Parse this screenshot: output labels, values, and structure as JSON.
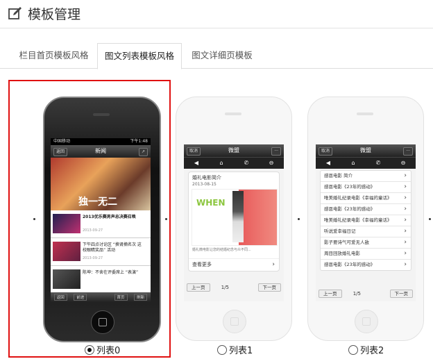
{
  "header": {
    "title": "模板管理"
  },
  "tabs": [
    "栏目首页模板风格",
    "图文列表模板风格",
    "图文详细页模板"
  ],
  "templates": [
    {
      "radio_label": "列表0",
      "selected": true,
      "screen": {
        "status_carrier": "中国移动",
        "status_time": "下午1:48",
        "back": "返回",
        "nav_title": "新闻",
        "hero_caption": "独一无二",
        "rows": [
          {
            "title": "2013优乐赛男声总决赛召唤",
            "date": "2013-09-27"
          },
          {
            "title": "下午四点讨论区 “换肾摘名次 这校眼睛奖品” 活动",
            "date": "2013-09-27"
          },
          {
            "title": "陈坤：不舍在评委席上 “表演”",
            "date": ""
          }
        ],
        "tabbar": [
          "返回",
          "前进",
          "首页",
          "刷新"
        ]
      }
    },
    {
      "radio_label": "列表1",
      "selected": false,
      "screen": {
        "back": "取消",
        "nav_title": "微盟",
        "card_title": "婚礼电影简介",
        "card_date": "2013-08-15",
        "card_text": "婚礼微电影让您的结婚纪念与众不同...",
        "ad_word": "WHEN",
        "more": "查看更多",
        "prev": "上一页",
        "page": "1/5",
        "next": "下一页"
      }
    },
    {
      "radio_label": "列表2",
      "selected": false,
      "screen": {
        "back": "取消",
        "nav_title": "微盟",
        "items": [
          "感恩电影 简介",
          "感恩电影《23年的感动》",
          "唯美婚礼纪录电影《幸福的童话》",
          "感恩电影《23年的感动》",
          "唯美婚礼纪录电影《幸福的童话》",
          "听说爱幸福日记",
          "影子要诗气可爱无人敌",
          "周目回放婚礼电影",
          "感恩电影《23年的感动》"
        ],
        "prev": "上一页",
        "page": "1/5",
        "next": "下一页"
      }
    }
  ]
}
